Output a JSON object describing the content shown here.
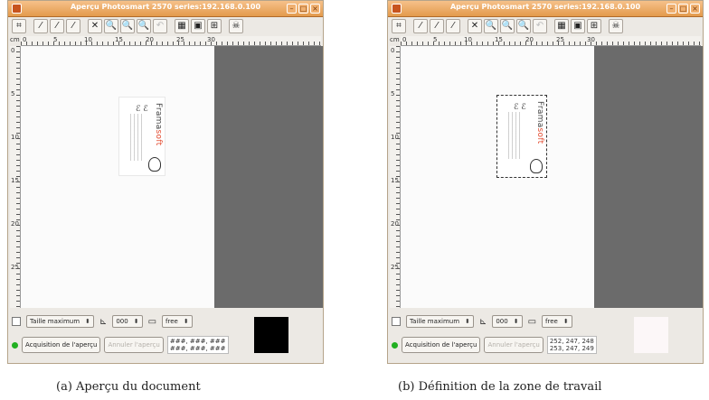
{
  "colors": {
    "titlebar": "#e39a4c",
    "canvas_bg": "#6b6b6b",
    "page_bg": "#fbfbfb",
    "status_led": "#21b021",
    "accent_red": "#e2472b"
  },
  "panels": [
    {
      "window_title": "Aperçu Photosmart 2570 series:192.168.0.100",
      "ruler_unit": "cm",
      "ruler_h_labels": [
        "0",
        "5",
        "10",
        "15",
        "20",
        "25",
        "30"
      ],
      "ruler_v_labels": [
        "0",
        "5",
        "10",
        "15",
        "20",
        "25",
        "30"
      ],
      "card_brand_prefix": "Frama",
      "card_brand_suffix": "soft",
      "size_combo": "Taille maximum",
      "rotation_combo": "000",
      "ratio_combo": "free",
      "acquire_button": "Acquisition de l'aperçu",
      "cancel_button": "Annuler l'aperçu",
      "rgb_line1": "###, ###, ###",
      "rgb_line2": "###, ###, ###",
      "swatch_color": "#000000",
      "selection_active": false,
      "caption": "(a) Aperçu du document"
    },
    {
      "window_title": "Aperçu Photosmart 2570 series:192.168.0.100",
      "ruler_unit": "cm",
      "ruler_h_labels": [
        "0",
        "5",
        "10",
        "15",
        "20",
        "25",
        "30"
      ],
      "ruler_v_labels": [
        "0",
        "5",
        "10",
        "15",
        "20",
        "25",
        "30"
      ],
      "card_brand_prefix": "Frama",
      "card_brand_suffix": "soft",
      "size_combo": "Taille maximum",
      "rotation_combo": "000",
      "ratio_combo": "free",
      "acquire_button": "Acquisition de l'aperçu",
      "cancel_button": "Annuler l'aperçu",
      "rgb_line1": "252, 247, 248",
      "rgb_line2": "253, 247, 249",
      "swatch_color": "#fcf7f8",
      "selection_active": true,
      "caption": "(b) Définition de la zone de travail"
    }
  ],
  "toolbar_icons": [
    "select-area-icon",
    "pick-white-icon",
    "pick-gray-icon",
    "pick-black-icon",
    "delete-selection-icon",
    "zoom-out-icon",
    "zoom-in-icon",
    "zoom-selection-icon",
    "zoom-undo-icon",
    "autoselect-icon",
    "full-area-icon",
    "new-area-icon",
    "ghostscript-icon"
  ]
}
